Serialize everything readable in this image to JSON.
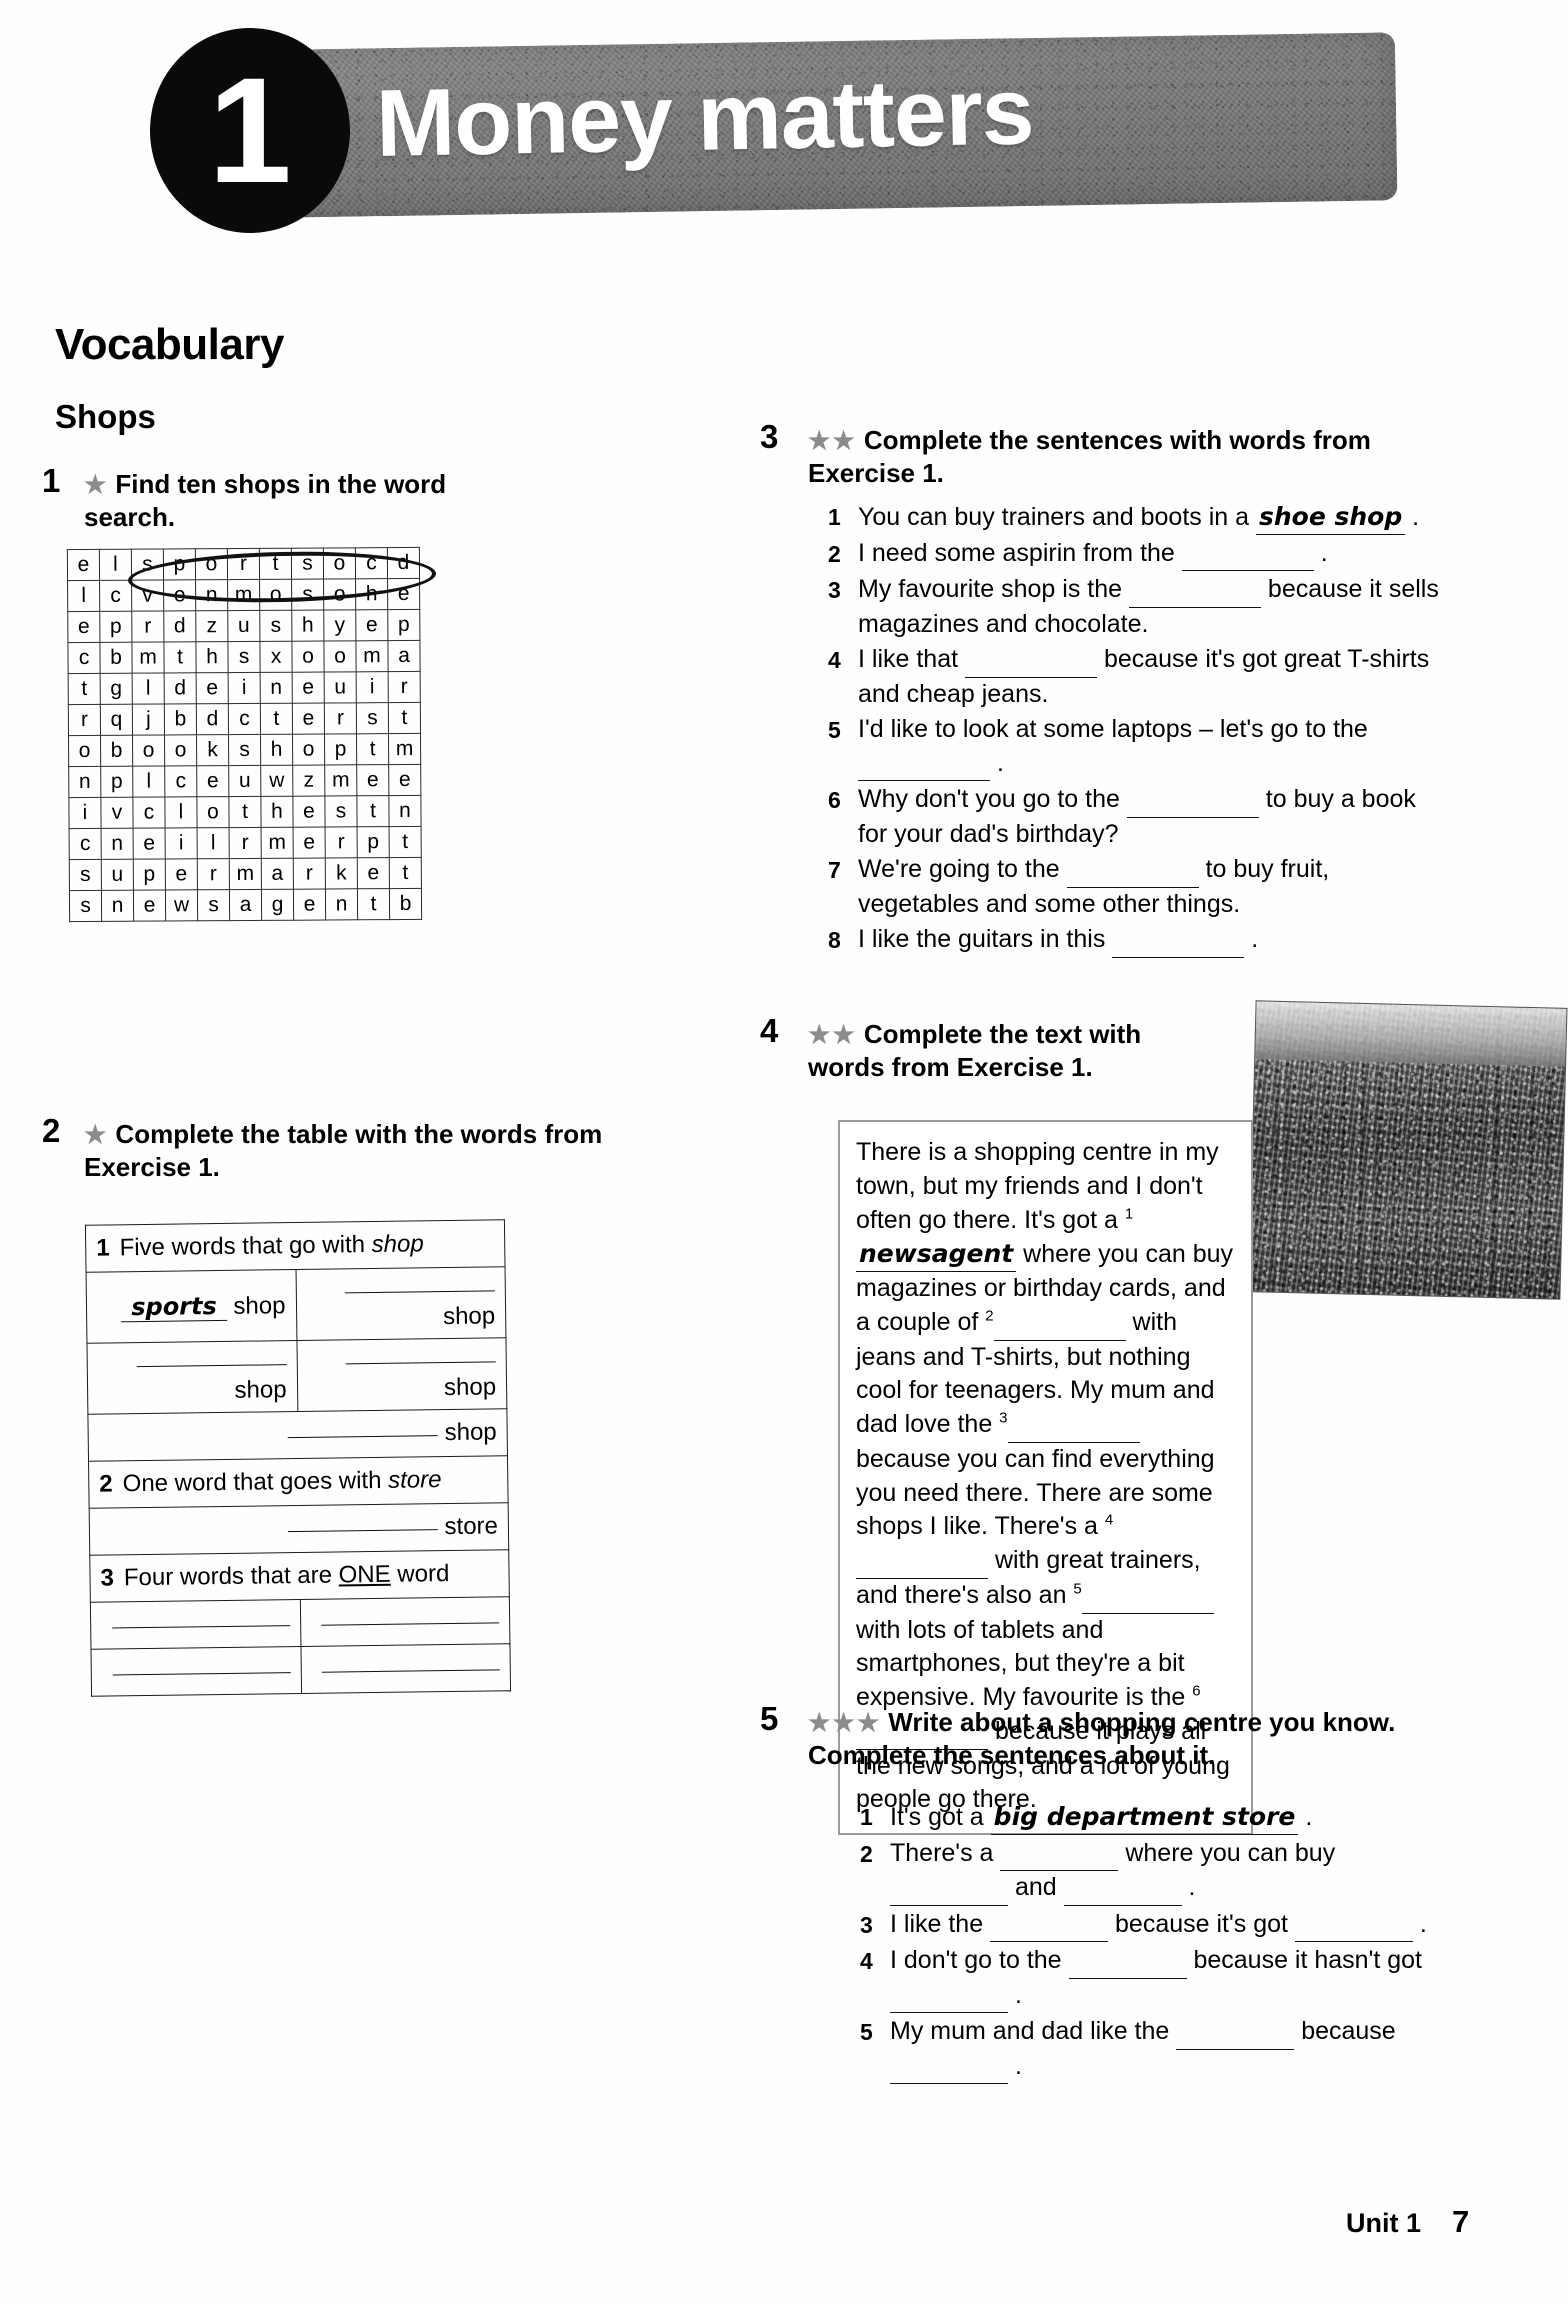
{
  "header": {
    "unit_number": "1",
    "title": "Money matters"
  },
  "section": {
    "vocabulary_heading": "Vocabulary",
    "topic_heading": "Shops"
  },
  "exercise1": {
    "number": "1",
    "stars": "★",
    "instruction": "Find ten shops in the word search.",
    "grid": [
      [
        "e",
        "l",
        "s",
        "p",
        "o",
        "r",
        "t",
        "s",
        "o",
        "c",
        "d"
      ],
      [
        "l",
        "c",
        "v",
        "e",
        "n",
        "m",
        "o",
        "s",
        "o",
        "h",
        "e"
      ],
      [
        "e",
        "p",
        "r",
        "d",
        "z",
        "u",
        "s",
        "h",
        "y",
        "e",
        "p"
      ],
      [
        "c",
        "b",
        "m",
        "t",
        "h",
        "s",
        "x",
        "o",
        "o",
        "m",
        "a"
      ],
      [
        "t",
        "g",
        "l",
        "d",
        "e",
        "i",
        "n",
        "e",
        "u",
        "i",
        "r"
      ],
      [
        "r",
        "q",
        "j",
        "b",
        "d",
        "c",
        "t",
        "e",
        "r",
        "s",
        "t"
      ],
      [
        "o",
        "b",
        "o",
        "o",
        "k",
        "s",
        "h",
        "o",
        "p",
        "t",
        "m"
      ],
      [
        "n",
        "p",
        "l",
        "c",
        "e",
        "u",
        "w",
        "z",
        "m",
        "e",
        "e"
      ],
      [
        "i",
        "v",
        "c",
        "l",
        "o",
        "t",
        "h",
        "e",
        "s",
        "t",
        "n"
      ],
      [
        "c",
        "n",
        "e",
        "i",
        "l",
        "r",
        "m",
        "e",
        "r",
        "p",
        "t"
      ],
      [
        "s",
        "u",
        "p",
        "e",
        "r",
        "m",
        "a",
        "r",
        "k",
        "e",
        "t"
      ],
      [
        "s",
        "n",
        "e",
        "w",
        "s",
        "a",
        "g",
        "e",
        "n",
        "t",
        "b"
      ]
    ],
    "circled_word": "sports"
  },
  "exercise2": {
    "number": "2",
    "stars": "★",
    "instruction": "Complete the table with the words from Exercise 1.",
    "rows": [
      {
        "type": "header",
        "num": "1",
        "text_before": "Five words that go with ",
        "italic": "shop"
      },
      {
        "type": "pair",
        "left_answer": "sports",
        "left_label": "shop",
        "right_answer": "",
        "right_label": "shop"
      },
      {
        "type": "pair",
        "left_answer": "",
        "left_label": "shop",
        "right_answer": "",
        "right_label": "shop"
      },
      {
        "type": "single",
        "left_answer": "",
        "left_label": "shop"
      },
      {
        "type": "header",
        "num": "2",
        "text_before": "One word that goes with ",
        "italic": "store"
      },
      {
        "type": "single",
        "left_answer": "",
        "left_label": "store"
      },
      {
        "type": "header",
        "num": "3",
        "text_before": "Four words that are ",
        "underline": "ONE",
        "text_after": " word"
      },
      {
        "type": "pair",
        "left_answer": "",
        "left_label": "",
        "right_answer": "",
        "right_label": ""
      },
      {
        "type": "pair",
        "left_answer": "",
        "left_label": "",
        "right_answer": "",
        "right_label": ""
      }
    ]
  },
  "exercise3": {
    "number": "3",
    "stars": "★★",
    "instruction": "Complete the sentences with words from Exercise 1.",
    "items": [
      {
        "num": "1",
        "before": "You can buy trainers and boots in a ",
        "answer": "shoe shop",
        "after": " ."
      },
      {
        "num": "2",
        "before": "I need some aspirin from the ",
        "answer": "",
        "after": " ."
      },
      {
        "num": "3",
        "before": "My favourite shop is the ",
        "answer": "",
        "after": " because it sells magazines and chocolate."
      },
      {
        "num": "4",
        "before": "I like that ",
        "answer": "",
        "after": " because it's got great T-shirts and cheap jeans."
      },
      {
        "num": "5",
        "before": "I'd like to look at some laptops – let's go to the ",
        "answer": "",
        "after": " ."
      },
      {
        "num": "6",
        "before": "Why don't you go to the ",
        "answer": "",
        "after": " to buy a book for your dad's birthday?"
      },
      {
        "num": "7",
        "before": "We're going to the ",
        "answer": "",
        "after": " to buy fruit, vegetables and some other things."
      },
      {
        "num": "8",
        "before": "I like the guitars in this ",
        "answer": "",
        "after": " ."
      }
    ]
  },
  "exercise4": {
    "number": "4",
    "stars": "★★",
    "instruction": "Complete the text with words from Exercise 1.",
    "text_parts": {
      "p1": "There is a shopping centre in my town, but my friends and I don't often go there. It's got a ",
      "sup1": "1",
      "ans1": "newsagent",
      "p2": " where you can buy magazines or birthday cards, and a couple of ",
      "sup2": "2",
      "p3": " with jeans and T-shirts, but nothing cool for teenagers. My mum and dad love the ",
      "sup3": "3",
      "p4": " because you can find everything you need there. There are some shops I like. There's a ",
      "sup4": "4",
      "p5": " with great trainers, and there's also an ",
      "sup5": "5",
      "p6": " with lots of tablets and smartphones, but they're a bit expensive. My favourite is the ",
      "sup6": "6",
      "p7": " because it plays all the new songs, and a lot of young people go there."
    },
    "photo_alt": "shopping-street-photo"
  },
  "exercise5": {
    "number": "5",
    "stars": "★★★",
    "instruction": "Write about a shopping centre you know. Complete the sentences about it.",
    "items": [
      {
        "num": "1",
        "before": "It's got a ",
        "answer": "big department store",
        "after": " ."
      },
      {
        "num": "2",
        "before": "There's a ",
        "answer": "",
        "after": " where you can buy ",
        "after2": " and ",
        "after3": " ."
      },
      {
        "num": "3",
        "before": "I like the ",
        "answer": "",
        "after": " because it's got ",
        "after2": " ."
      },
      {
        "num": "4",
        "before": "I don't go to the ",
        "answer": "",
        "after": " because it hasn't got ",
        "after2": " ."
      },
      {
        "num": "5",
        "before": "My mum and dad like the ",
        "answer": "",
        "after": " because ",
        "after2": " ."
      }
    ]
  },
  "footer": {
    "unit_label": "Unit 1",
    "page_number": "7"
  }
}
